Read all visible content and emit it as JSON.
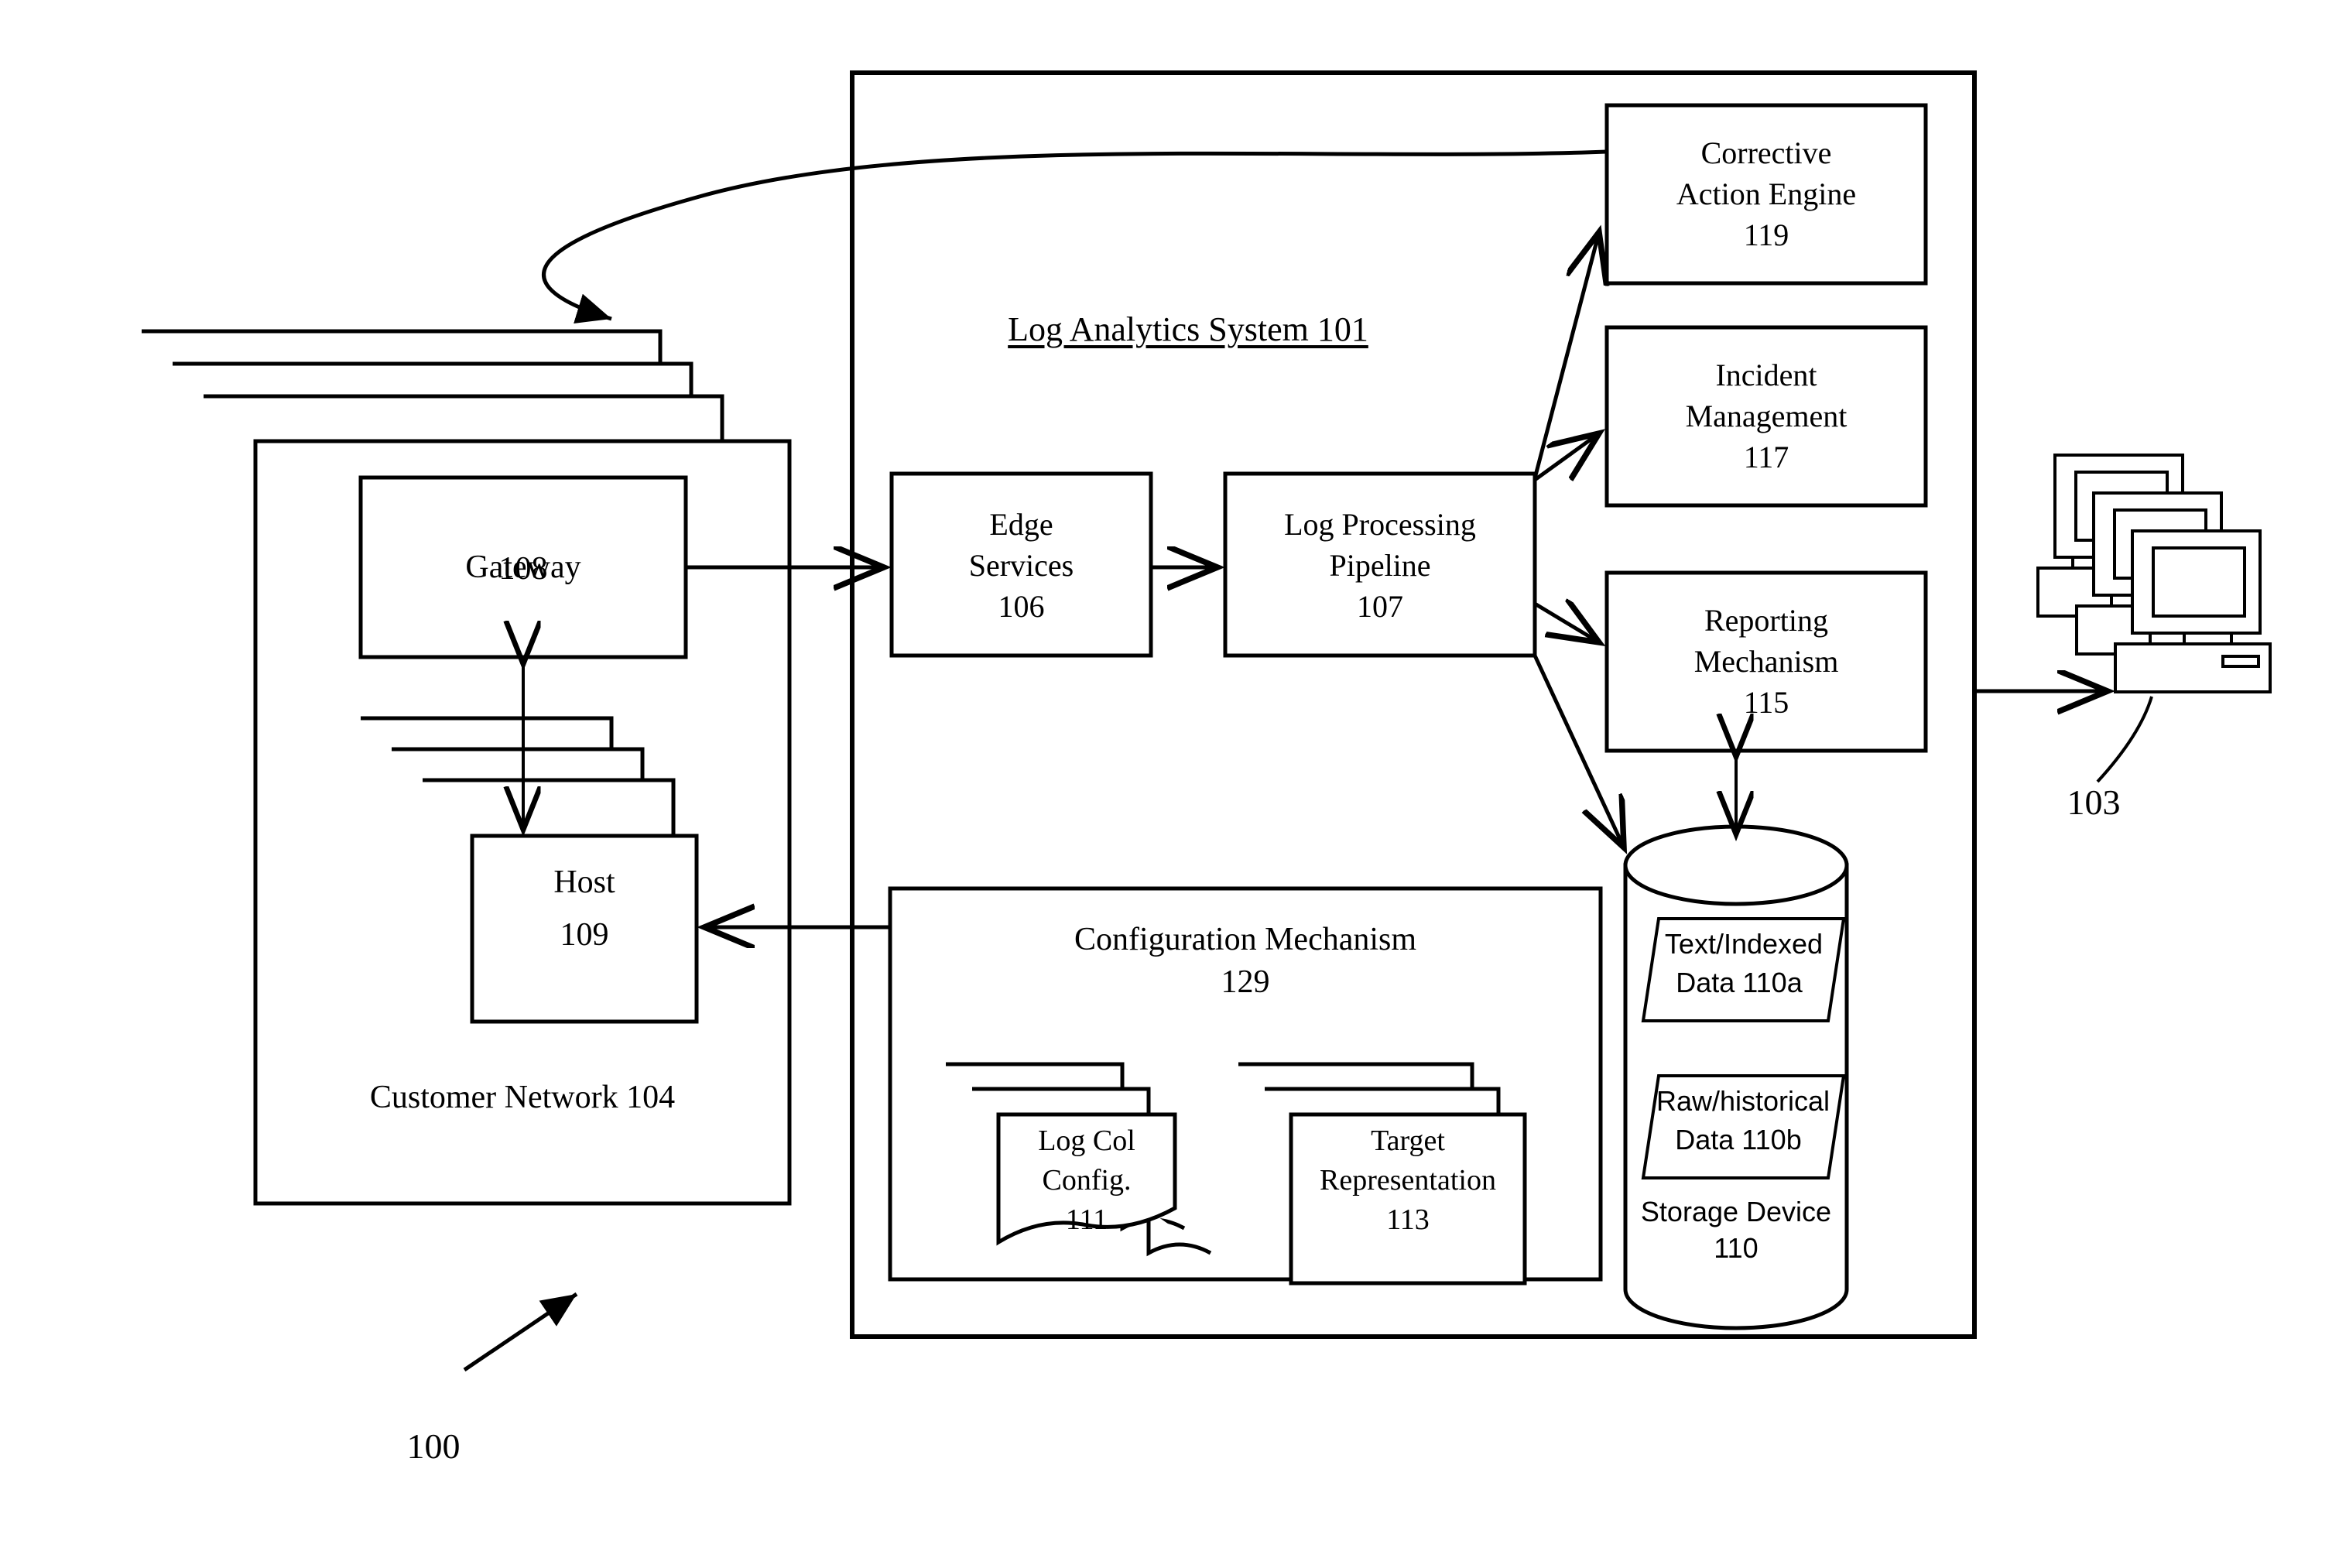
{
  "figure": {
    "number": "100",
    "system_title": "Log Analytics System 101",
    "client_label": "103"
  },
  "customer_network": {
    "panel_label": "Customer Network 104",
    "gateway": {
      "line1": "Gateway",
      "line2": "108"
    },
    "host": {
      "line1": "Host",
      "line2": "109"
    }
  },
  "pipeline": {
    "edge_services": {
      "line1": "Edge",
      "line2": "Services",
      "line3": "106"
    },
    "log_processing": {
      "line1": "Log Processing",
      "line2": "Pipeline",
      "line3": "107"
    }
  },
  "engines": {
    "corrective": {
      "line1": "Corrective",
      "line2": "Action Engine",
      "line3": "119"
    },
    "incident": {
      "line1": "Incident",
      "line2": "Management",
      "line3": "117"
    },
    "reporting": {
      "line1": "Reporting",
      "line2": "Mechanism",
      "line3": "115"
    }
  },
  "storage": {
    "title": "Storage Device",
    "number": "110",
    "indexed": {
      "line1": "Text/Indexed",
      "line2": "Data 110a"
    },
    "raw": {
      "line1": "Raw/historical",
      "line2": "Data 110b"
    }
  },
  "configuration": {
    "title": "Configuration Mechanism",
    "number": "129",
    "log_col_config": {
      "line1": "Log Col",
      "line2": "Config.",
      "line3": "111"
    },
    "target_representation": {
      "line1": "Target",
      "line2": "Representation",
      "line3": "113"
    }
  },
  "icons": {
    "computer_stack": "computer-stack-icon",
    "storage_cylinder": "database-cylinder-icon",
    "document_stack": "document-stack-icon",
    "panel_stack": "panel-stack-icon"
  },
  "colors": {
    "stroke": "#000000",
    "fill": "#ffffff"
  }
}
